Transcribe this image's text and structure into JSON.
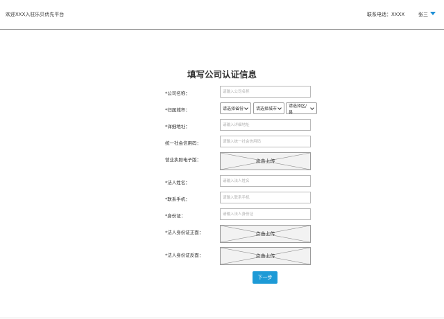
{
  "header": {
    "welcome": "欢迎XXX入驻乐贝优先平台",
    "contact": "联系电话：XXXX",
    "user": "张三"
  },
  "form": {
    "title": "填写公司认证信息",
    "company_name": {
      "label": "*公司名称：",
      "placeholder": "请输入公司名称"
    },
    "city": {
      "label": "*归属城市：",
      "province": "请选择省份",
      "city": "请选择城市",
      "district": "请选择区/县"
    },
    "address": {
      "label": "*详细地址：",
      "placeholder": "请输入详细地址"
    },
    "credit_code": {
      "label": "统一社会信用码：",
      "placeholder": "请输入统一社会信用码"
    },
    "license": {
      "label": "营业执照电子版：",
      "upload": "点击上传"
    },
    "legal_name": {
      "label": "*法人姓名：",
      "placeholder": "请输入法人姓名"
    },
    "phone": {
      "label": "*联系手机：",
      "placeholder": "请输入联系手机"
    },
    "id_card": {
      "label": "*身份证：",
      "placeholder": "请输入法人身份证"
    },
    "id_front": {
      "label": "*法人身份证正面：",
      "upload": "点击上传"
    },
    "id_back": {
      "label": "*法人身份证反面：",
      "upload": "点击上传"
    },
    "next": "下一步"
  },
  "colors": {
    "accent": "#1d9ad6",
    "border": "#b8b8b8"
  },
  "icons": {
    "user_menu": "caret-down-icon",
    "select": "chevron-down-icon"
  }
}
